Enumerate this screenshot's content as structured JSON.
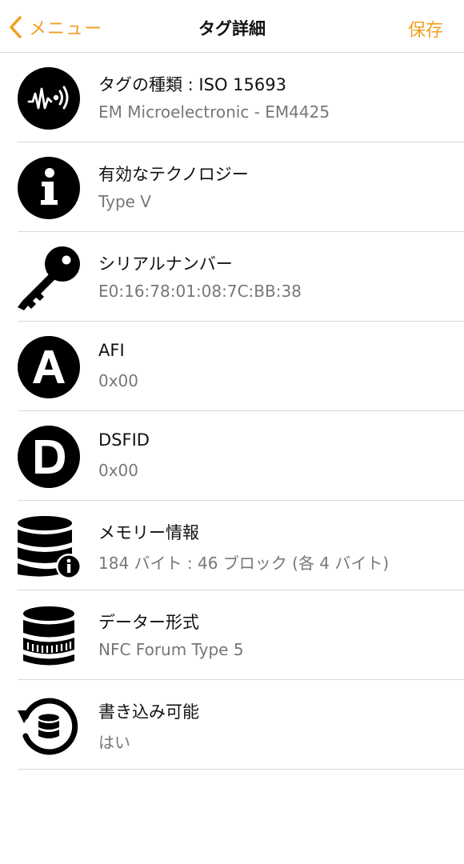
{
  "navbar": {
    "back_label": "メニュー",
    "title": "タグ詳細",
    "save_label": "保存",
    "accent_color": "#f0a023"
  },
  "rows": [
    {
      "icon": "nfc-signal-icon",
      "title": "タグの種類 : ISO 15693",
      "subtitle": "EM Microelectronic - EM4425"
    },
    {
      "icon": "info-icon",
      "title": "有効なテクノロジー",
      "subtitle": "Type V"
    },
    {
      "icon": "key-icon",
      "title": "シリアルナンバー",
      "subtitle": "E0:16:78:01:08:7C:BB:38"
    },
    {
      "icon": "letter-a-icon",
      "title": "AFI",
      "subtitle": "0x00"
    },
    {
      "icon": "letter-d-icon",
      "title": "DSFID",
      "subtitle": "0x00"
    },
    {
      "icon": "database-info-icon",
      "title": "メモリー情報",
      "subtitle": "184 バイト : 46 ブロック (各 4 バイト)"
    },
    {
      "icon": "data-format-icon",
      "title": "データー形式",
      "subtitle": "NFC Forum Type 5"
    },
    {
      "icon": "database-refresh-icon",
      "title": "書き込み可能",
      "subtitle": "はい"
    }
  ]
}
